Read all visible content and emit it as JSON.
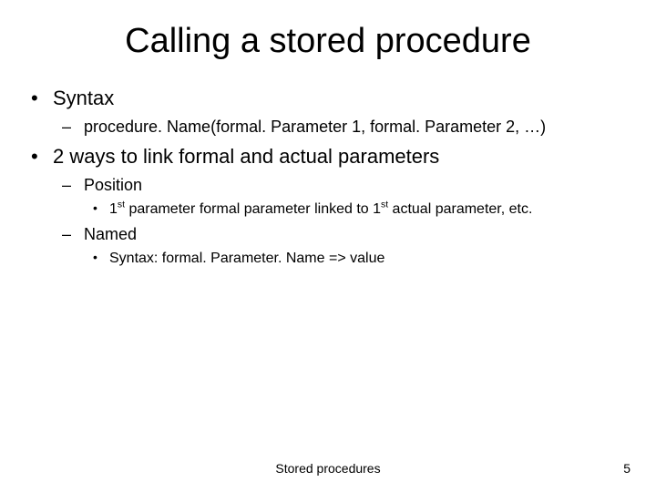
{
  "title": "Calling a stored procedure",
  "bullets": {
    "b1": "Syntax",
    "b1_1": "procedure. Name(formal. Parameter 1, formal. Parameter 2, …)",
    "b2": "2 ways to link formal and actual parameters",
    "b2_1": "Position",
    "b2_1_1_pre": "1",
    "b2_1_1_sup": "st",
    "b2_1_1_mid": " parameter formal parameter linked to 1",
    "b2_1_1_sup2": "st",
    "b2_1_1_post": " actual parameter, etc.",
    "b2_2": "Named",
    "b2_2_1": "Syntax: formal. Parameter. Name => value"
  },
  "footer": {
    "center": "Stored procedures",
    "page": "5"
  }
}
